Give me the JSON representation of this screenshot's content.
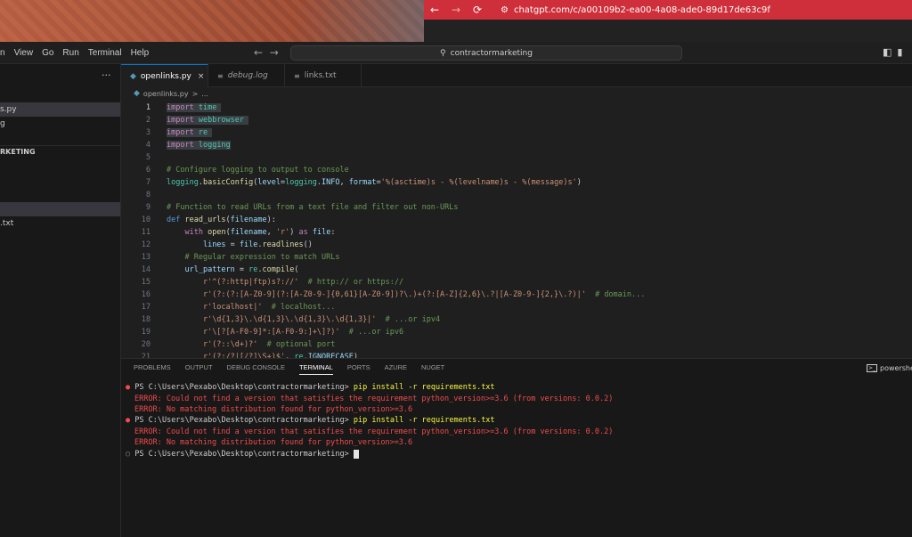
{
  "browser": {
    "url": "chatgpt.com/c/a00109b2-ea00-4a08-ade0-89d17de63c9f",
    "accent": "#cf2f3a"
  },
  "menu": [
    "n",
    "View",
    "Go",
    "Run",
    "Terminal",
    "Help"
  ],
  "command_center": {
    "text": "contractormarketing"
  },
  "sidebar": {
    "rows": [
      {
        "label": "s.py",
        "selected": true
      },
      {
        "label": "g",
        "selected": false
      },
      {
        "label": "RKETING",
        "selected": false,
        "heading": true
      },
      {
        "label": "",
        "selected": true
      },
      {
        "label": ".txt",
        "selected": false
      }
    ]
  },
  "tabs": [
    {
      "label": "openlinks.py",
      "icon": "python-icon",
      "active": true
    },
    {
      "label": "debug.log",
      "icon": "lines-icon",
      "active": false,
      "italic": true
    },
    {
      "label": "links.txt",
      "icon": "lines-icon",
      "active": false
    }
  ],
  "breadcrumb": {
    "file": "openlinks.py",
    "rest": "..."
  },
  "editor": {
    "lines": [
      "1",
      "2",
      "3",
      "4",
      "5",
      "6",
      "7",
      "8",
      "9",
      "10",
      "11",
      "12",
      "13",
      "14",
      "15",
      "16",
      "17",
      "18",
      "19",
      "20",
      "21"
    ]
  },
  "panel": {
    "tabs": [
      "PROBLEMS",
      "OUTPUT",
      "DEBUG CONSOLE",
      "TERMINAL",
      "PORTS",
      "AZURE",
      "NUGET"
    ],
    "active_tab": "TERMINAL",
    "shell": "powershe",
    "terminal": {
      "prompt": "PS C:\\Users\\Pexabo\\Desktop\\contractormarketing>",
      "command": "pip install -r requirements.txt",
      "err1": "ERROR: Could not find a version that satisfies the requirement python_version>=3.6 (from versions: 0.0.2)",
      "err2": "ERROR: No matching distribution found for python_version>=3.6"
    }
  }
}
